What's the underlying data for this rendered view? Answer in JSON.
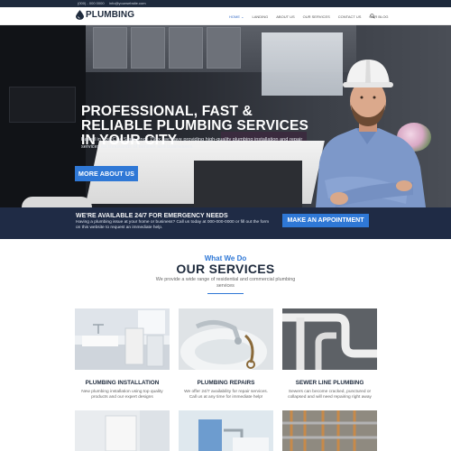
{
  "topbar": {
    "phone": "(000) - 000 0000",
    "email": "info@yourwebsite.com"
  },
  "header": {
    "logo_text": "PLUMBING",
    "nav": [
      {
        "label": "HOME ⌄",
        "active": true
      },
      {
        "label": "LANDING",
        "active": false
      },
      {
        "label": "ABOUT US",
        "active": false
      },
      {
        "label": "OUR SERVICES",
        "active": false
      },
      {
        "label": "CONTACT US",
        "active": false
      },
      {
        "label": "OUR BLOG",
        "active": false
      }
    ],
    "search_icon": "search-icon"
  },
  "hero": {
    "title": "PROFESSIONAL, FAST & RELIABLE PLUMBING SERVICES IN YOUR CITY",
    "text": "Based in YourCity, State since 19xx, we have providing high-quality plumbing installation and repair services for thousands of families and businesses.",
    "button": "MORE ABOUT US"
  },
  "emergency": {
    "title": "WE'RE AVAILABLE 24/7 FOR EMERGENCY NEEDS",
    "text": "Having a plumbing issue at your home or business? Call us today at 000-000-0000 or fill out the form on this website to request an immediate help.",
    "button": "MAKE AN APPOINTMENT"
  },
  "services": {
    "pretitle": "What We Do",
    "title": "OUR SERVICES",
    "subtitle": "We provide a wide range of residential and commercial plumbing services",
    "cards": [
      {
        "title": "PLUMBING INSTALLATION",
        "text": "New plumbing installation using top quality products and our expert designs"
      },
      {
        "title": "PLUMBING REPAIRS",
        "text": "We offer 24/7 availability for repair services. Call us at any time for immediate help!"
      },
      {
        "title": "SEWER LINE PLUMBING",
        "text": "Sewers can become cracked, punctured or collapsed and will need repairing right away"
      }
    ]
  },
  "colors": {
    "accent": "#2f78d6",
    "navy": "#1f2b45",
    "dark": "#1e2a3c"
  }
}
